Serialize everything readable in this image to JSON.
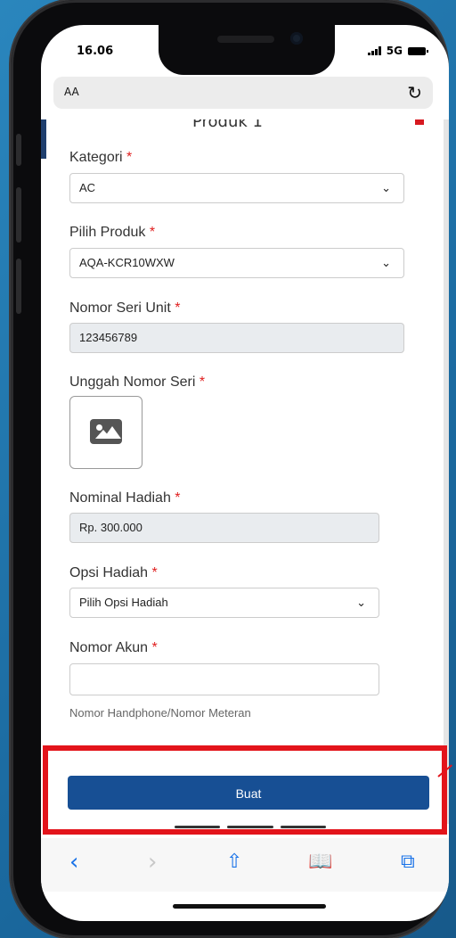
{
  "status_bar": {
    "time": "16.06",
    "network": "5G"
  },
  "address_bar": {
    "text": "AA"
  },
  "form": {
    "section_title": "Produk 1",
    "required_mark": "*",
    "kategori": {
      "label": "Kategori",
      "value": "AC"
    },
    "pilih_produk": {
      "label": "Pilih Produk",
      "value": "AQA-KCR10WXW"
    },
    "nomor_seri": {
      "label": "Nomor Seri Unit",
      "value": "123456789"
    },
    "unggah": {
      "label": "Unggah Nomor Seri"
    },
    "nominal": {
      "label": "Nominal Hadiah",
      "value": "Rp. 300.000"
    },
    "opsi": {
      "label": "Opsi Hadiah",
      "value": "Pilih Opsi Hadiah"
    },
    "nomor_akun": {
      "label": "Nomor Akun",
      "value": "",
      "hint": "Nomor Handphone/Nomor Meteran"
    }
  },
  "actions": {
    "submit_label": "Buat"
  },
  "colors": {
    "primary": "#174f94",
    "highlight": "#e3141b",
    "required": "#e02020"
  }
}
